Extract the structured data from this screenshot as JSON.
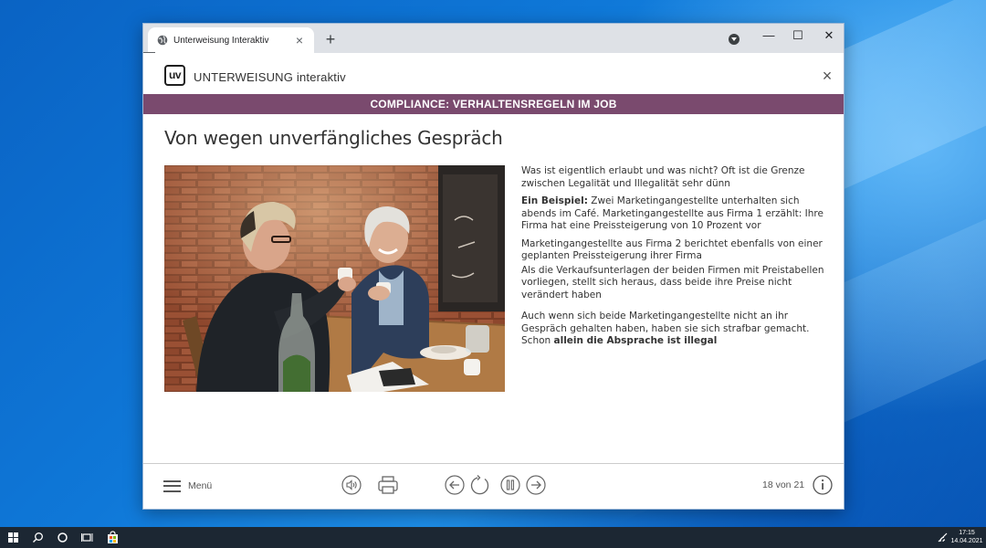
{
  "browser": {
    "tab_title": "Unterweisung Interaktiv",
    "tab_close": "×",
    "new_tab": "+",
    "minimize": "—",
    "maximize": "☐",
    "close": "✕",
    "expander": "››"
  },
  "app": {
    "logo_text": "uv",
    "title": "UNTERWEISUNG interaktiv",
    "close": "×",
    "banner": "COMPLIANCE: VERHALTENSREGELN IM JOB",
    "page_title": "Von wegen unverfängliches Gespräch"
  },
  "content": {
    "p1": "Was ist eigentlich erlaubt und was nicht? Oft ist die Grenze zwischen Legalität und Illegalität sehr dünn",
    "p2_bold": "Ein Beispiel:",
    "p2_rest": " Zwei Marketingangestellte unterhalten sich abends im Café. Marketingangestellte aus Firma 1 erzählt: Ihre Firma hat eine Preissteigerung von 10 Prozent vor",
    "p3": "Marketingangestellte aus Firma 2 berichtet ebenfalls von einer geplanten Preissteigerung ihrer Firma",
    "p4": "Als die Verkaufsunterlagen der beiden Firmen mit Preistabellen vorliegen, stellt sich heraus, dass beide ihre Preise nicht verändert haben",
    "p5_rest": "Auch wenn sich beide Marketingangestellte nicht an ihr Gespräch gehalten haben, haben sie sich strafbar gemacht.  Schon ",
    "p5_bold": "allein die Absprache ist illegal"
  },
  "footer": {
    "menu_label": "Menü",
    "page_count": "18 von 21",
    "icons": [
      "sound-icon",
      "print-icon",
      "back-icon",
      "reload-icon",
      "pause-icon",
      "forward-icon",
      "info-icon"
    ]
  },
  "taskbar": {
    "time": "17:15",
    "date": "14.04.2021"
  },
  "colors": {
    "banner": "#7a4a6e",
    "taskbar": "#1c2733",
    "desktop": "#0f78d8"
  }
}
